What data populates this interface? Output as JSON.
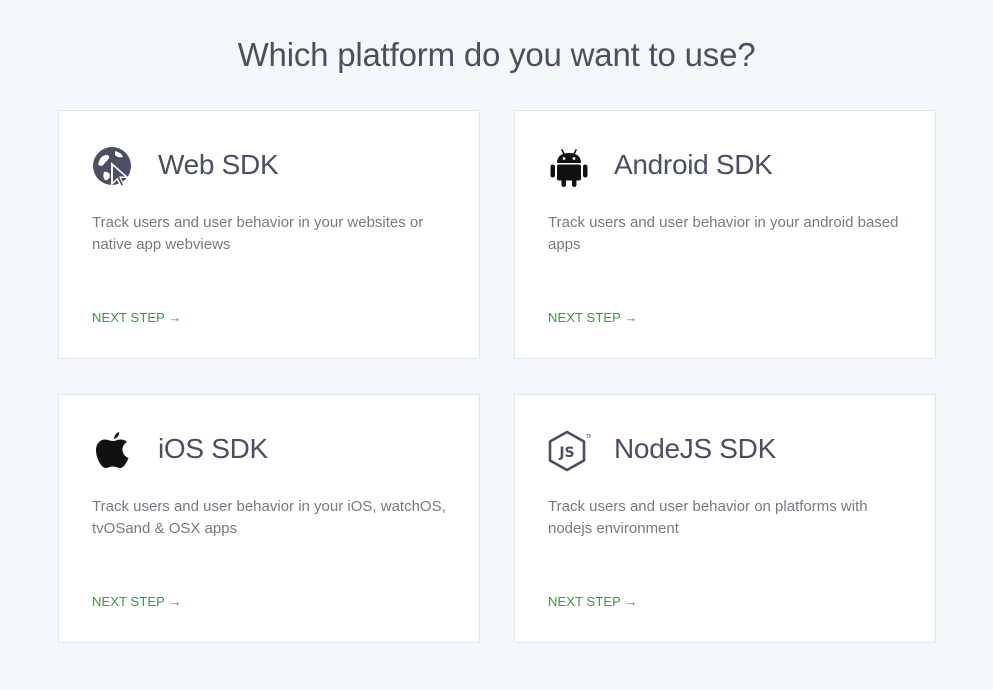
{
  "page": {
    "title": "Which platform do you want to use?"
  },
  "cards": [
    {
      "icon": "web-cursor-icon",
      "title": "Web SDK",
      "description": "Track users and user behavior in your websites or native app webviews",
      "link": "NEXT STEP →"
    },
    {
      "icon": "android-icon",
      "title": "Android SDK",
      "description": "Track users and user behavior in your android based apps",
      "link": "NEXT STEP →"
    },
    {
      "icon": "apple-icon",
      "title": "iOS SDK",
      "description": "Track users and user behavior in your iOS, watchOS, tvOSand & OSX apps",
      "link": "NEXT STEP →"
    },
    {
      "icon": "nodejs-icon",
      "title": "NodeJS SDK",
      "description": "Track users and user behavior on platforms with nodejs environment",
      "link": "NEXT STEP →"
    }
  ],
  "colors": {
    "background": "#f5f8fa",
    "card": "#ffffff",
    "title_text": "#4b4f63",
    "body_text": "#757a86",
    "link": "#3c9a3c",
    "icon_dark": "#4b4f63",
    "icon_black": "#111111"
  }
}
